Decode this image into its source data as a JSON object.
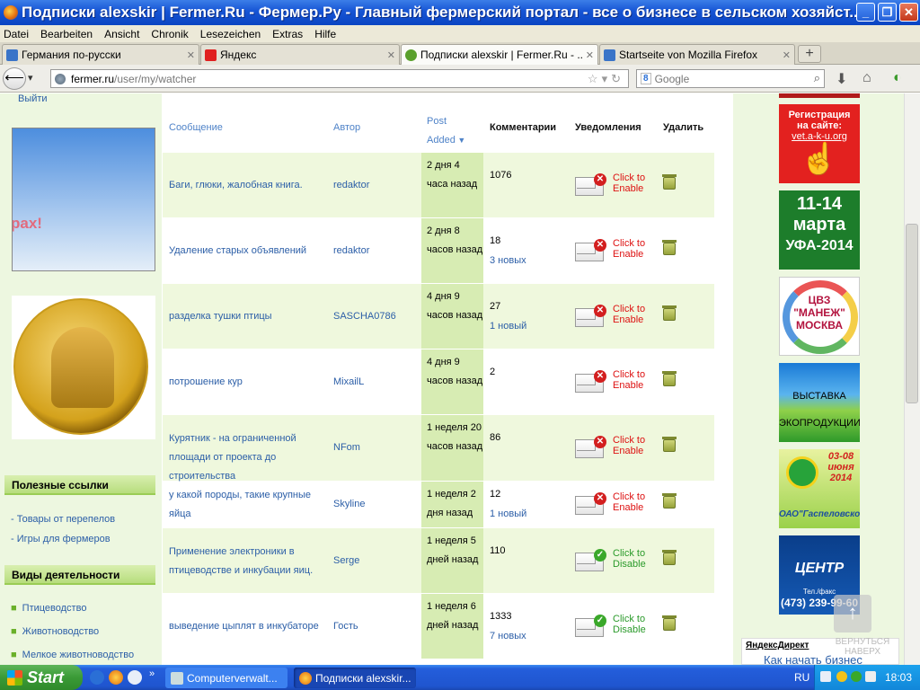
{
  "window": {
    "title": "Подписки alexskir | Fermer.Ru - Фермер.Ру - Главный фермерский портал - все о бизнесе в сельском хозяйст..."
  },
  "menu": [
    "Datei",
    "Bearbeiten",
    "Ansicht",
    "Chronik",
    "Lesezeichen",
    "Extras",
    "Hilfe"
  ],
  "tabs": [
    {
      "label": "Германия по-русски",
      "icon": "germany-ru-icon",
      "color": "#3a74c8"
    },
    {
      "label": "Яндекс",
      "icon": "yandex-icon",
      "color": "#e02020"
    },
    {
      "label": "Подписки alexskir | Fermer.Ru - ...",
      "icon": "fermer-icon",
      "color": "#5aa02c"
    },
    {
      "label": "Startseite von Mozilla Firefox",
      "icon": "firefox-start-icon",
      "color": "#3a74c8"
    }
  ],
  "url": {
    "host": "fermer.ru",
    "path": "/user/my/watcher"
  },
  "search": {
    "placeholder": "Google",
    "engine": "8"
  },
  "left": {
    "exit": "Выйти",
    "ad_text": "рах!",
    "section_links": "Полезные ссылки",
    "links": [
      "- Товары от перепелов",
      "- Игры для фермеров"
    ],
    "section_activities": "Виды деятельности",
    "activities": [
      "Птицеводство",
      "Животноводство",
      "Мелкое животноводство"
    ]
  },
  "table": {
    "headers": {
      "message": "Сообщение",
      "author": "Автор",
      "post_added": "Post Added",
      "comments": "Комментарии",
      "notifications": "Уведомления",
      "delete": "Удалить"
    },
    "rows": [
      {
        "message": "Баги, глюки, жалобная книга.",
        "author": "redaktor",
        "post": "2 дня 4 часа назад",
        "comments": "1076",
        "new": "",
        "state": "Click to Enable"
      },
      {
        "message": "Удаление старых объявлений",
        "author": "redaktor",
        "post": "2 дня 8 часов назад",
        "comments": "18",
        "new": "3 новых",
        "state": "Click to Enable"
      },
      {
        "message": "разделка тушки птицы",
        "author": "SASCHA0786",
        "post": "4 дня 9 часов назад",
        "comments": "27",
        "new": "1 новый",
        "state": "Click to Enable"
      },
      {
        "message": "потрошение кур",
        "author": "MixailL",
        "post": "4 дня 9 часов назад",
        "comments": "2",
        "new": "",
        "state": "Click to Enable"
      },
      {
        "message": "Курятник - на ограниченной площади от проекта до строительства",
        "author": "NFom",
        "post": "1 неделя 20 часов назад",
        "comments": "86",
        "new": "",
        "state": "Click to Enable"
      },
      {
        "message": "у какой породы, такие крупные яйца",
        "author": "Skyline",
        "post": "1 неделя 2 дня назад",
        "comments": "12",
        "new": "1 новый",
        "state": "Click to Enable"
      },
      {
        "message": "Применение электроники в птицеводстве и инкубации яиц.",
        "author": "Serge",
        "post": "1 неделя 5 дней назад",
        "comments": "110",
        "new": "",
        "state": "Click to Disable"
      },
      {
        "message": "выведение цыплят в инкубаторе",
        "author": "Гость",
        "post": "1 неделя 6 дней назад",
        "comments": "1333",
        "new": "7 новых",
        "state": "Click to Disable"
      }
    ]
  },
  "ads": {
    "reg_line1": "Регистрация",
    "reg_line2": "на сайте:",
    "reg_url": "vet.a-k-u.org",
    "ufa_line1": "11-14",
    "ufa_line2": "марта",
    "ufa_line3": "УФА-2014",
    "manezh_line1": "ЦВЗ",
    "manezh_line2": "\"МАНЕЖ\"",
    "manezh_line3": "МОСКВА",
    "vyst_line1": "ВЫСТАВКА",
    "vyst_line2": "ЭКОПРОДУКЦИИ",
    "gast_dates": "03-08 июня 2014",
    "gast_name": "ОАО\"Гаспеловское\"",
    "centr_name": "ЦЕНТР",
    "centr_tel": "Тел./факс",
    "centr_phone": "(473) 239-99-60"
  },
  "up": {
    "arrow": "↑",
    "text": "ВЕРНУТЬСЯ НАВЕРХ"
  },
  "yandex_direct": {
    "title": "ЯндексДирект",
    "link": "Как начать бизнес"
  },
  "taskbar": {
    "start": "Start",
    "tasks": [
      "Computerverwalt...",
      "Подписки alexskir..."
    ],
    "lang": "RU",
    "time": "18:03"
  }
}
